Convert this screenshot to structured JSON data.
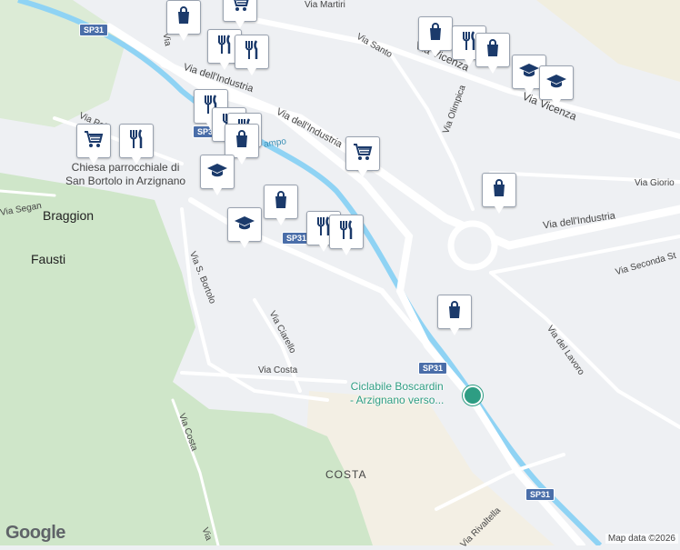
{
  "map": {
    "streets": [
      {
        "name": "Via dell'Industria"
      },
      {
        "name": "Via dell'Industria"
      },
      {
        "name": "Via dell'Industria"
      },
      {
        "name": "Via Vicenza"
      },
      {
        "name": "Via Vicenza"
      },
      {
        "name": "Via Santo"
      },
      {
        "name": "Via Olimpica"
      },
      {
        "name": "Via Giorio"
      },
      {
        "name": "Via Seconda St"
      },
      {
        "name": "Via del Lavoro"
      },
      {
        "name": "Via S. Bortolo"
      },
      {
        "name": "Via Ciarello"
      },
      {
        "name": "Via Costa"
      },
      {
        "name": "Via Costa"
      },
      {
        "name": "Via Rivaltella"
      },
      {
        "name": "Via Segan"
      },
      {
        "name": "Via Pol"
      },
      {
        "name": "Via"
      },
      {
        "name": "Via Martiri"
      },
      {
        "name": "Via"
      },
      {
        "name": "ampo"
      }
    ],
    "places": [
      "Braggion",
      "Fausti",
      "COSTA"
    ],
    "church": [
      "Chiesa parrocchiale di",
      "San Bortolo in Arzignano"
    ],
    "poi": [
      "Ciclabile Boscardin",
      "- Arzignano verso..."
    ],
    "road_shields": [
      "SP31",
      "SP31",
      "SP31",
      "SP31",
      "SP31"
    ],
    "markers": [
      "bag-icon",
      "cart-icon",
      "bag-icon",
      "fork-knife-icon",
      "fork-knife-icon",
      "fork-knife-icon",
      "bag-icon",
      "grad-cap-icon",
      "grad-cap-icon",
      "fork-knife-icon",
      "fork-knife-icon",
      "fork-knife-icon",
      "bag-icon",
      "cart-icon",
      "fork-knife-icon",
      "grad-cap-icon",
      "cart-icon",
      "bag-icon",
      "bag-icon",
      "grad-cap-icon",
      "fork-knife-icon",
      "fork-knife-icon",
      "bag-icon"
    ]
  },
  "footer": {
    "logo": "Google",
    "attribution": "Map data ©2026"
  },
  "colors": {
    "water": "#8fd3f4",
    "green": "#c8e3c2",
    "road": "#ffffff",
    "marker_icon": "#1b3a6b",
    "poi": "#2e9d83"
  }
}
